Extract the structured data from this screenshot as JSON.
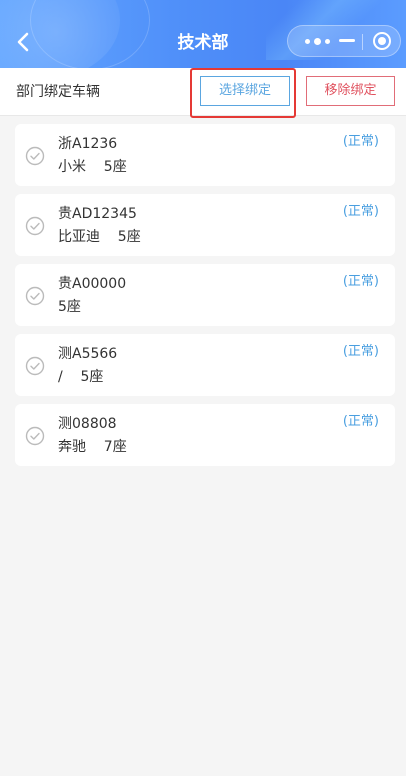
{
  "header": {
    "title": "技术部",
    "back_icon": "chevron-left-icon",
    "capsule": {
      "more_icon": "more-dots-icon",
      "minimize_icon": "minus-icon",
      "close_icon": "target-circle-icon"
    },
    "gradient_colors": [
      "#63a6ff",
      "#4a86f6"
    ]
  },
  "toolbar": {
    "label": "部门绑定车辆",
    "select_label": "选择绑定",
    "remove_label": "移除绑定",
    "select_color": "#5ba6e0",
    "remove_color": "#e0525f",
    "highlight_color": "#e53935"
  },
  "vehicles": [
    {
      "plate": "浙A1236",
      "desc": "小米    5座",
      "status": "(正常)"
    },
    {
      "plate": "贵AD12345",
      "desc": "比亚迪    5座",
      "status": "(正常)"
    },
    {
      "plate": "贵A00000",
      "desc": "5座",
      "status": "(正常)"
    },
    {
      "plate": "测A5566",
      "desc": "/    5座",
      "status": "(正常)"
    },
    {
      "plate": "测08808",
      "desc": "奔驰    7座",
      "status": "(正常)"
    }
  ],
  "colors": {
    "status": "#4a9fe0",
    "background": "#f5f5f5",
    "check": "#bbbbbb"
  }
}
